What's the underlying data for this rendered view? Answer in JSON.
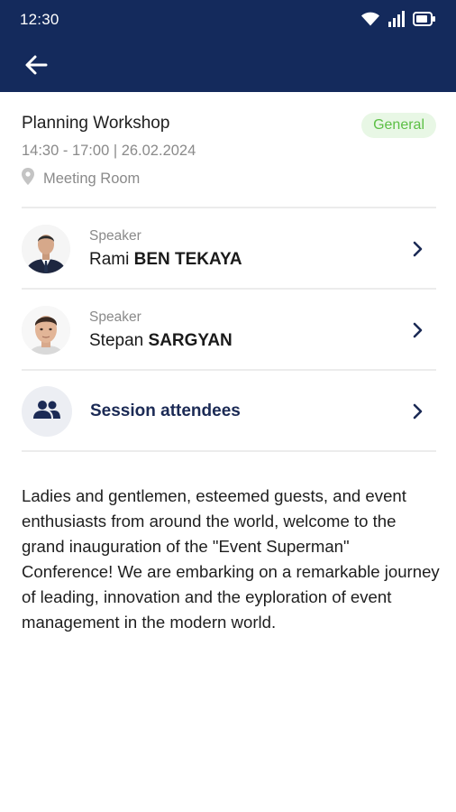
{
  "status_bar": {
    "time": "12:30",
    "icons": [
      "wifi-icon",
      "signal-icon",
      "battery-icon"
    ]
  },
  "app_bar": {
    "back_icon": "arrow-left-icon",
    "color": "#142a5c"
  },
  "session": {
    "title": "Planning Workshop",
    "category": "General",
    "time": "14:30 - 17:00 | 26.02.2024",
    "location": "Meeting Room",
    "location_icon": "location-pin-icon",
    "badge_bg": "#e8f7e5",
    "badge_color": "#5cbf45"
  },
  "speakers": [
    {
      "role": "Speaker",
      "first_name": "Rami",
      "last_name": "BEN TEKAYA"
    },
    {
      "role": "Speaker",
      "first_name": "Stepan",
      "last_name": "SARGYAN"
    }
  ],
  "attendees": {
    "label": "Session attendees",
    "icon": "people-icon"
  },
  "description": "Ladies and gentlemen, esteemed guests, and event enthusiasts from around the world, welcome to the grand inauguration of the \"Event Superman\" Conference! We are embarking on a remarkable journey of leading, innovation and the eyploration of event management in the modern world."
}
